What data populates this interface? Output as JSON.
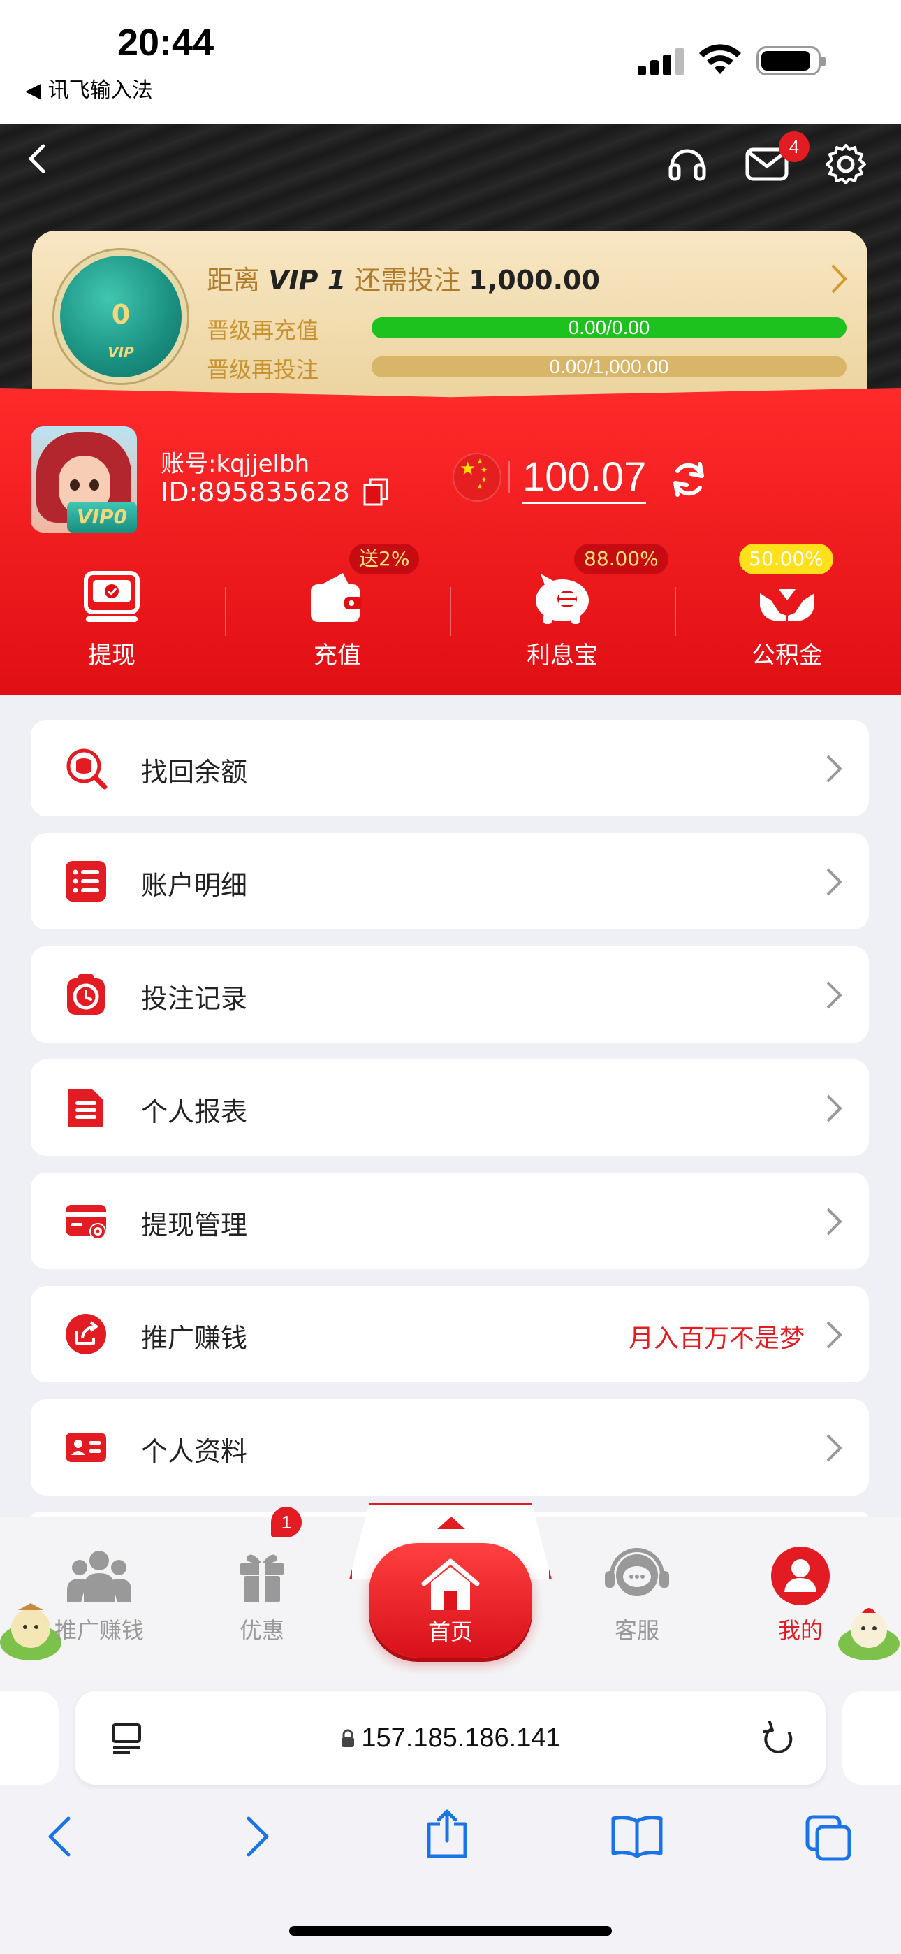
{
  "status": {
    "time": "20:44",
    "back_app": "◀ 讯飞输入法"
  },
  "header": {
    "mail_count": "4"
  },
  "vip": {
    "medal_level": "0",
    "medal_label": "VIP",
    "title_prefix": "距离",
    "title_level": "VIP 1",
    "title_mid": "还需投注",
    "title_amount": "1,000.00",
    "recharge_label": "晋级再充值",
    "recharge_progress": "0.00/0.00",
    "recharge_fraction": 1.0,
    "bet_label": "晋级再投注",
    "bet_progress": "0.00/1,000.00",
    "bet_fraction": 0.0,
    "colors": {
      "green": "#1ec21e",
      "gold": "#d9b56a"
    }
  },
  "user": {
    "account": "账号:kqjjelbh",
    "id": "ID:895835628",
    "vip_badge": "VIP0",
    "balance": "100.07"
  },
  "actions": [
    {
      "label": "提现",
      "tag": ""
    },
    {
      "label": "充值",
      "tag": "送2%"
    },
    {
      "label": "利息宝",
      "tag": "88.00%"
    },
    {
      "label": "公积金",
      "tag": "50.00%"
    }
  ],
  "menu": [
    {
      "label": "找回余额",
      "icon": "search-coin-icon",
      "right": ""
    },
    {
      "label": "账户明细",
      "icon": "list-icon",
      "right": ""
    },
    {
      "label": "投注记录",
      "icon": "clock-icon",
      "right": ""
    },
    {
      "label": "个人报表",
      "icon": "document-icon",
      "right": ""
    },
    {
      "label": "提现管理",
      "icon": "card-gear-icon",
      "right": ""
    },
    {
      "label": "推广赚钱",
      "icon": "share-icon",
      "right": "月入百万不是梦"
    },
    {
      "label": "个人资料",
      "icon": "id-card-icon",
      "right": ""
    }
  ],
  "nav": {
    "promote": "推广赚钱",
    "offers": "优惠",
    "offers_badge": "1",
    "home": "首页",
    "service": "客服",
    "mine": "我的"
  },
  "browser": {
    "url": "157.185.186.141"
  },
  "colors": {
    "accent": "#e31b23",
    "brand_red": "#ff2a2a"
  }
}
